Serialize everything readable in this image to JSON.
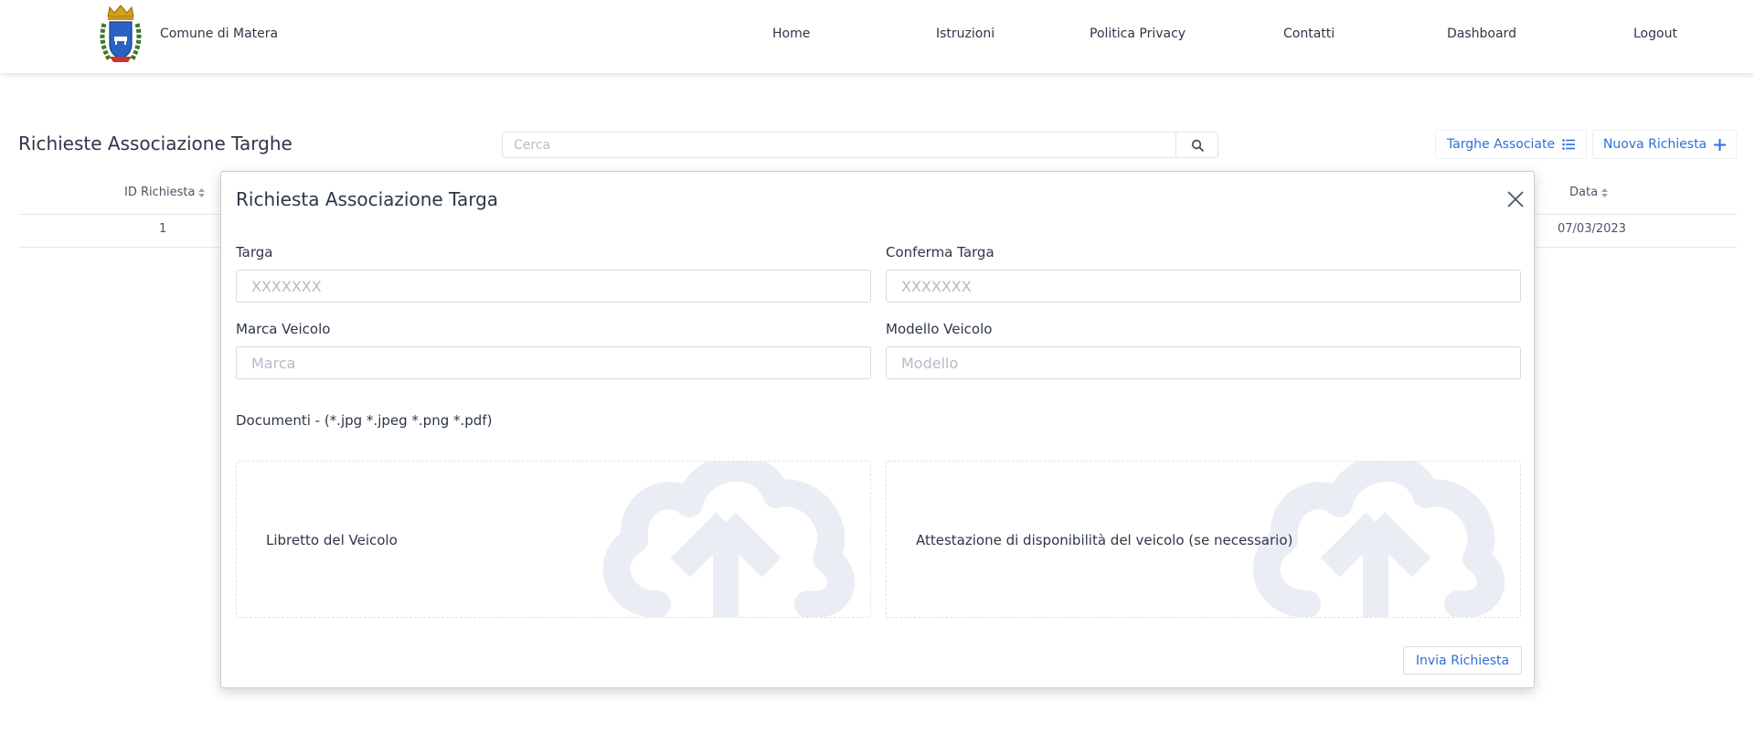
{
  "header": {
    "brand": "Comune di Matera",
    "nav": [
      {
        "label": "Home"
      },
      {
        "label": "Istruzioni"
      },
      {
        "label": "Politica Privacy"
      },
      {
        "label": "Contatti"
      },
      {
        "label": "Dashboard"
      },
      {
        "label": "Logout"
      }
    ]
  },
  "page": {
    "title": "Richieste Associazione Targhe",
    "search": {
      "placeholder": "Cerca",
      "value": ""
    },
    "buttons": {
      "associated": "Targhe Associate",
      "new_request": "Nuova Richiesta"
    }
  },
  "table": {
    "columns": {
      "id": "ID Richiesta",
      "date": "Data"
    },
    "rows": [
      {
        "id": "1",
        "date": "07/03/2023"
      }
    ]
  },
  "modal": {
    "title": "Richiesta Associazione Targa",
    "fields": {
      "targa": {
        "label": "Targa",
        "placeholder": "XXXXXXX",
        "value": ""
      },
      "conferma_targa": {
        "label": "Conferma Targa",
        "placeholder": "XXXXXXX",
        "value": ""
      },
      "marca": {
        "label": "Marca Veicolo",
        "placeholder": "Marca",
        "value": ""
      },
      "modello": {
        "label": "Modello Veicolo",
        "placeholder": "Modello",
        "value": ""
      }
    },
    "documents_label": "Documenti - (*.jpg *.jpeg *.png *.pdf)",
    "uploads": [
      {
        "label": "Libretto del Veicolo",
        "icon": "cloud-upload-icon"
      },
      {
        "label": "Attestazione di disponibilità del veicolo (se necessario)",
        "icon": "cloud-upload-icon"
      }
    ],
    "submit_label": "Invia Richiesta"
  },
  "colors": {
    "accent": "#2f6fd8",
    "text": "#2d3748",
    "cloud": "#eaeef4"
  }
}
